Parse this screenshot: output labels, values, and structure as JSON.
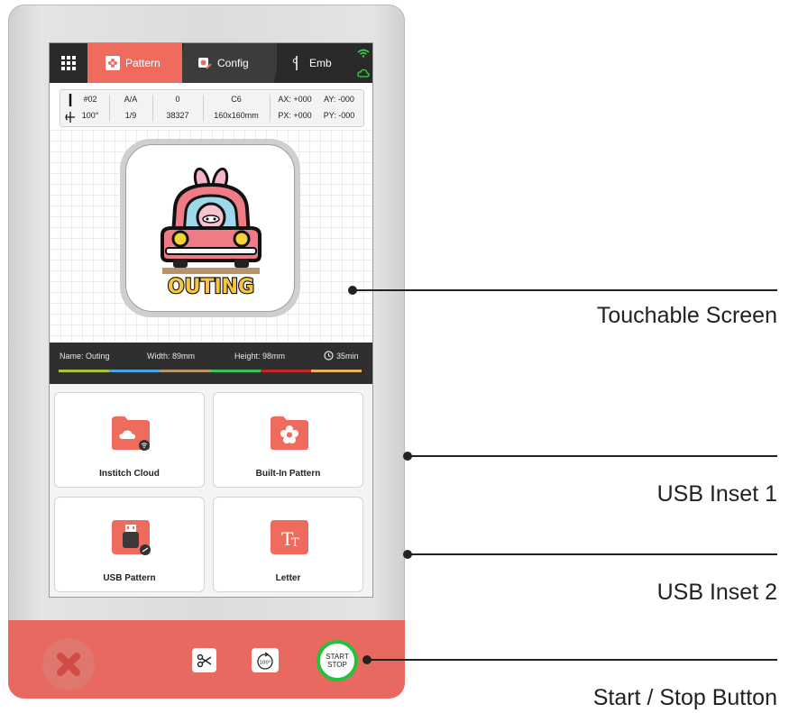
{
  "tabs": {
    "pattern": "Pattern",
    "config": "Config",
    "emb": "Emb"
  },
  "info_panel": {
    "needle": "#02",
    "angle": "100°",
    "ratio_top": "A/A",
    "ratio_bottom": "1/9",
    "count_top": "0",
    "count_bottom": "38327",
    "color_top": "C6",
    "size_bottom": "160x160mm",
    "ax": "AX: +000",
    "ay": "AY: -000",
    "px": "PX: +000",
    "py": "PY: -000"
  },
  "design": {
    "art_text": "OUTING"
  },
  "design_info": {
    "name": "Name: Outing",
    "width": "Width: 89mm",
    "height": "Height: 98mm",
    "time": "35min",
    "thread_colors": [
      "#a8c43a",
      "#4aa3df",
      "#b89468",
      "#3fbf5f",
      "#c0262c",
      "#e7b25a"
    ]
  },
  "tiles": {
    "cloud": "Institch Cloud",
    "builtin": "Built-In Pattern",
    "usb": "USB Pattern",
    "letter": "Letter"
  },
  "bottom_controls": {
    "start_line1": "START",
    "start_line2": "STOP",
    "rotate_label": "100°"
  },
  "callouts": {
    "screen": "Touchable Screen",
    "usb1": "USB Inset 1",
    "usb2": "USB Inset 2",
    "start_stop": "Start / Stop Button"
  },
  "colors": {
    "accent": "#ef6b5e",
    "device_bottom": "#e8695f",
    "topbar": "#2a2a2a",
    "start_ring": "#22c33a"
  }
}
